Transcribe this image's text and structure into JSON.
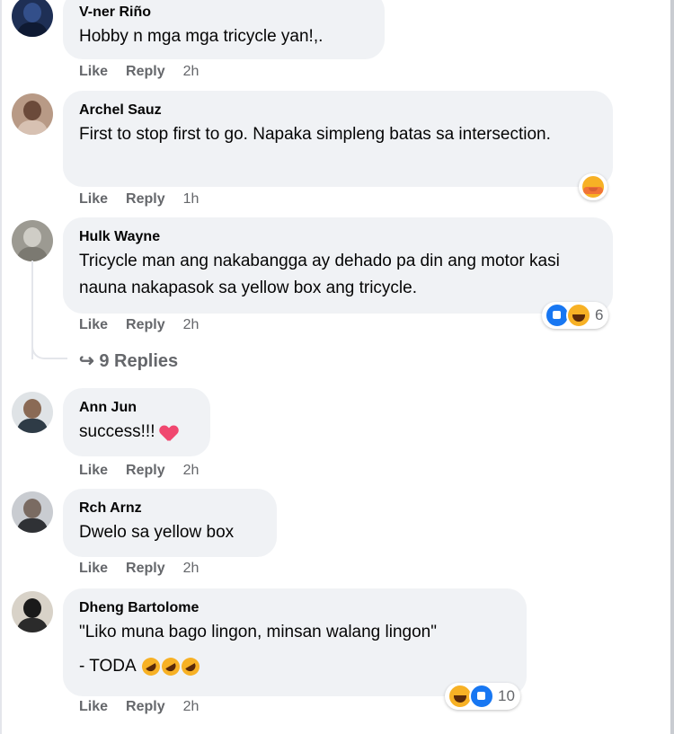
{
  "actions": {
    "like": "Like",
    "reply": "Reply"
  },
  "comments": [
    {
      "author": "V-ner Riño",
      "text": "Hobby n mga mga tricycle yan!,.",
      "time": "2h"
    },
    {
      "author": "Archel Sauz",
      "text": "First to stop first to go. Napaka simpleng batas sa intersection.",
      "time": "1h",
      "reactions": {
        "icons": [
          "care-face-icon"
        ]
      }
    },
    {
      "author": "Hulk Wayne",
      "text": "Tricycle man ang nakabangga ay dehado pa din ang motor kasi nauna nakapasok sa yellow box ang tricycle.",
      "time": "2h",
      "reactions": {
        "icons": [
          "like-icon",
          "haha-icon"
        ],
        "count": "6"
      }
    },
    {
      "author": "Ann Jun",
      "text": "success!!!",
      "time": "2h",
      "emoji": "heart-icon"
    },
    {
      "author": "Rch Arnz",
      "text": "Dwelo sa yellow box",
      "time": "2h"
    },
    {
      "author": "Dheng Bartolome",
      "text": "\"Liko muna bago lingon, minsan walang lingon\"",
      "text2": "- TODA",
      "emoji": "rofl-icon",
      "time": "2h",
      "reactions": {
        "icons": [
          "haha-icon",
          "like-icon"
        ],
        "count": "10"
      }
    }
  ],
  "replies_link": {
    "arrow": "↪",
    "label": "9 Replies"
  },
  "colors": {
    "bubble": "#f0f2f5",
    "meta": "#65676b",
    "like_blue": "#1877f2",
    "haha_yellow": "#f7b125"
  }
}
